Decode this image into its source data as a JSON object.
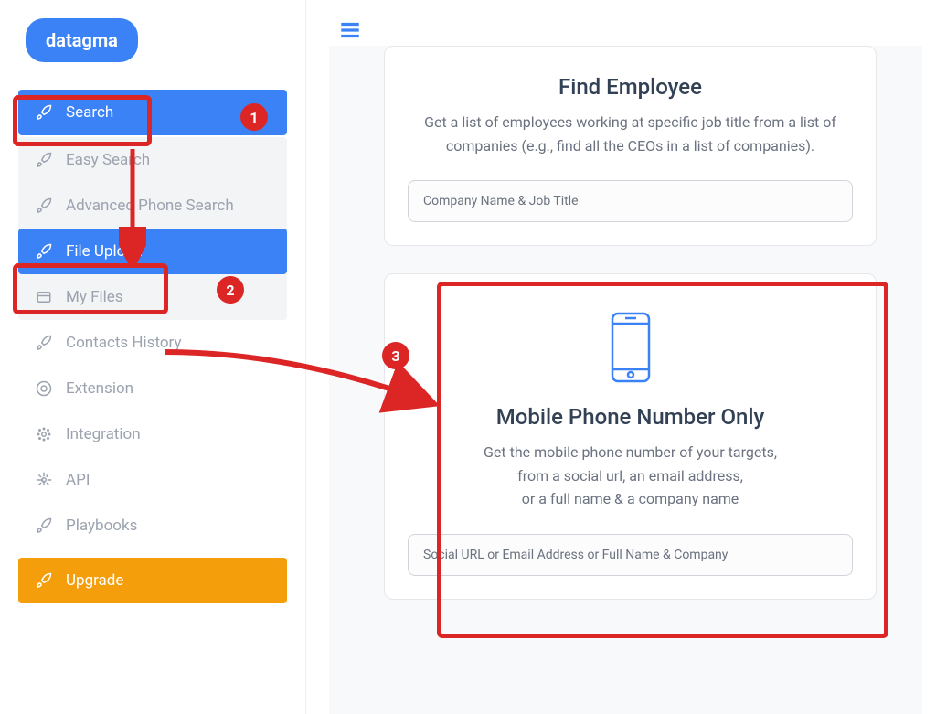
{
  "brand": "datagma",
  "sidebar": {
    "items": [
      {
        "label": "Search",
        "active": true
      },
      {
        "label": "Easy Search",
        "active": false
      },
      {
        "label": "Advanced Phone Search",
        "active": false
      },
      {
        "label": "File Upload",
        "active": true
      },
      {
        "label": "My Files",
        "active": false
      },
      {
        "label": "Contacts History",
        "active": false
      },
      {
        "label": "Extension",
        "active": false
      },
      {
        "label": "Integration",
        "active": false
      },
      {
        "label": "API",
        "active": false
      },
      {
        "label": "Playbooks",
        "active": false
      }
    ],
    "upgrade": "Upgrade"
  },
  "annotations": {
    "badge1": "1",
    "badge2": "2",
    "badge3": "3"
  },
  "cards": {
    "findEmployee": {
      "title": "Find Employee",
      "desc": "Get a list of employees working at specific job title from a list of companies (e.g., find all the CEOs in a list of companies).",
      "placeholder": "Company Name & Job Title"
    },
    "mobilePhone": {
      "title": "Mobile Phone Number Only",
      "descLine1": "Get the mobile phone number of your targets,",
      "descLine2": "from a social url, an email address,",
      "descLine3": "or a full name & a company name",
      "placeholder": "Social URL or Email Address or Full Name & Company"
    }
  }
}
